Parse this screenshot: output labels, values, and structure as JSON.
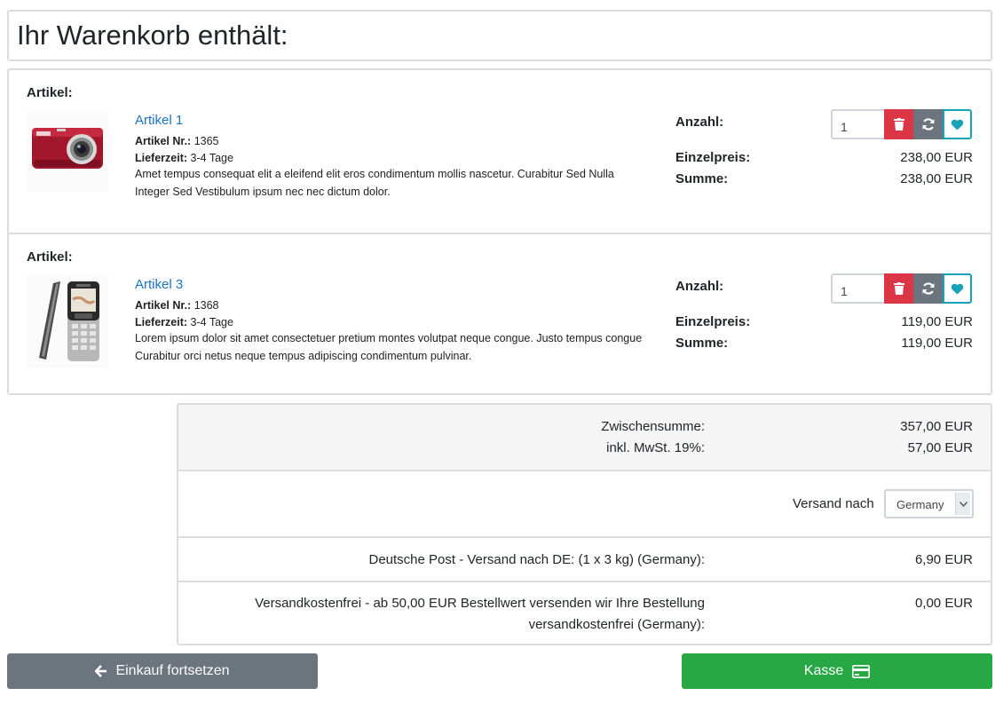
{
  "page": {
    "title": "Ihr Warenkorb enthält:"
  },
  "labels": {
    "article": "Artikel:",
    "article_no": "Artikel Nr.:",
    "delivery": "Lieferzeit:",
    "quantity": "Anzahl:",
    "unit_price": "Einzelpreis:",
    "sum": "Summe:"
  },
  "items": [
    {
      "name": "Artikel 1",
      "number": "1365",
      "delivery_time": "3-4 Tage",
      "description": "Amet tempus consequat elit a eleifend elit eros condimentum mollis nascetur. Curabitur Sed Nulla Integer Sed Vestibulum ipsum nec nec dictum dolor.",
      "quantity": "1",
      "unit_price": "238,00 EUR",
      "sum": "238,00 EUR",
      "image": "camera"
    },
    {
      "name": "Artikel 3",
      "number": "1368",
      "delivery_time": "3-4 Tage",
      "description": "Lorem ipsum dolor sit amet consectetuer pretium montes volutpat neque congue. Justo tempus congue Curabitur orci netus neque tempus adipiscing condimentum pulvinar.",
      "quantity": "1",
      "unit_price": "119,00 EUR",
      "sum": "119,00 EUR",
      "image": "phone"
    }
  ],
  "totals": {
    "subtotal_label": "Zwischensumme:",
    "subtotal_value": "357,00 EUR",
    "vat_label": "inkl. MwSt. 19%:",
    "vat_value": "57,00 EUR",
    "shipping_to_label": "Versand nach",
    "shipping_country": "Germany",
    "shipping_method_label": "Deutsche Post - Versand nach DE: (1 x 3 kg) (Germany):",
    "shipping_method_value": "6,90 EUR",
    "free_shipping_label_1": "Versandkostenfrei - ab 50,00 EUR Bestellwert versenden wir Ihre Bestellung",
    "free_shipping_label_2": "versandkostenfrei (Germany):",
    "free_shipping_value": "0,00 EUR"
  },
  "buttons": {
    "continue_shopping": "Einkauf fortsetzen",
    "checkout": "Kasse"
  },
  "icons": {
    "delete": "trash-icon",
    "refresh": "refresh-icon",
    "wishlist": "heart-icon",
    "back": "arrow-left-icon",
    "checkout": "credit-card-icon"
  },
  "colors": {
    "link": "#1a73c7",
    "danger": "#dc3545",
    "secondary": "#6c757d",
    "info": "#17a2b8",
    "success": "#28a745"
  }
}
